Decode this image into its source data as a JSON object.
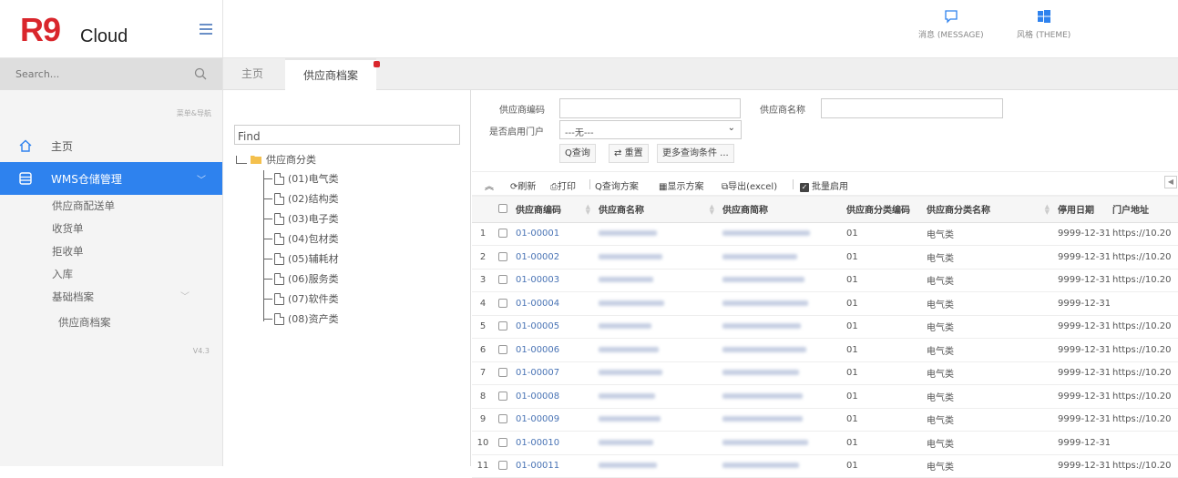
{
  "brand": {
    "logo_main": "R9",
    "logo_sub": "Cloud"
  },
  "search": {
    "placeholder": "Search..."
  },
  "sidebar": {
    "caption": "菜单&导航",
    "home": "主页",
    "active_module": "WMS仓储管理",
    "items": [
      "供应商配送单",
      "收货单",
      "拒收单",
      "入库"
    ],
    "group": "基础档案",
    "group_items": [
      "供应商档案"
    ],
    "version": "V4.3"
  },
  "topbar": {
    "message": "消息 (MESSAGE)",
    "theme": "风格 (THEME)"
  },
  "tabs": [
    {
      "label": "主页"
    },
    {
      "label": "供应商档案"
    }
  ],
  "tree": {
    "find_value": "Find",
    "root": "供应商分类",
    "nodes": [
      "(01)电气类",
      "(02)结构类",
      "(03)电子类",
      "(04)包材类",
      "(05)辅耗材",
      "(06)服务类",
      "(07)软件类",
      "(08)资产类"
    ]
  },
  "form": {
    "supplier_code_label": "供应商编码",
    "supplier_name_label": "供应商名称",
    "portal_label": "是否启用门户",
    "portal_value": "---无---",
    "query_button": "Q查询",
    "reset_button": "重置",
    "more_button": "更多查询条件 ..."
  },
  "toolbar": {
    "refresh": "刷新",
    "print": "打印",
    "query_plan": "Q查询方案",
    "display_plan": "显示方案",
    "export": "导出(excel)",
    "batch_enable": "批量启用"
  },
  "grid": {
    "columns": [
      "供应商编码",
      "供应商名称",
      "供应商简称",
      "供应商分类编码",
      "供应商分类名称",
      "停用日期",
      "门户地址"
    ],
    "rows": [
      {
        "n": "1",
        "code": "01-00001",
        "cat_code": "01",
        "cat_name": "电气类",
        "stop": "9999-12-31",
        "url": "https://10.20"
      },
      {
        "n": "2",
        "code": "01-00002",
        "cat_code": "01",
        "cat_name": "电气类",
        "stop": "9999-12-31",
        "url": "https://10.20"
      },
      {
        "n": "3",
        "code": "01-00003",
        "cat_code": "01",
        "cat_name": "电气类",
        "stop": "9999-12-31",
        "url": "https://10.20"
      },
      {
        "n": "4",
        "code": "01-00004",
        "cat_code": "01",
        "cat_name": "电气类",
        "stop": "9999-12-31",
        "url": ""
      },
      {
        "n": "5",
        "code": "01-00005",
        "cat_code": "01",
        "cat_name": "电气类",
        "stop": "9999-12-31",
        "url": "https://10.20"
      },
      {
        "n": "6",
        "code": "01-00006",
        "cat_code": "01",
        "cat_name": "电气类",
        "stop": "9999-12-31",
        "url": "https://10.20"
      },
      {
        "n": "7",
        "code": "01-00007",
        "cat_code": "01",
        "cat_name": "电气类",
        "stop": "9999-12-31",
        "url": "https://10.20"
      },
      {
        "n": "8",
        "code": "01-00008",
        "cat_code": "01",
        "cat_name": "电气类",
        "stop": "9999-12-31",
        "url": "https://10.20"
      },
      {
        "n": "9",
        "code": "01-00009",
        "cat_code": "01",
        "cat_name": "电气类",
        "stop": "9999-12-31",
        "url": "https://10.20"
      },
      {
        "n": "10",
        "code": "01-00010",
        "cat_code": "01",
        "cat_name": "电气类",
        "stop": "9999-12-31",
        "url": ""
      },
      {
        "n": "11",
        "code": "01-00011",
        "cat_code": "01",
        "cat_name": "电气类",
        "stop": "9999-12-31",
        "url": "https://10.20"
      }
    ]
  },
  "colors": {
    "accent": "#2e82ee",
    "brand_red": "#d9262c",
    "link": "#4a74b5"
  }
}
